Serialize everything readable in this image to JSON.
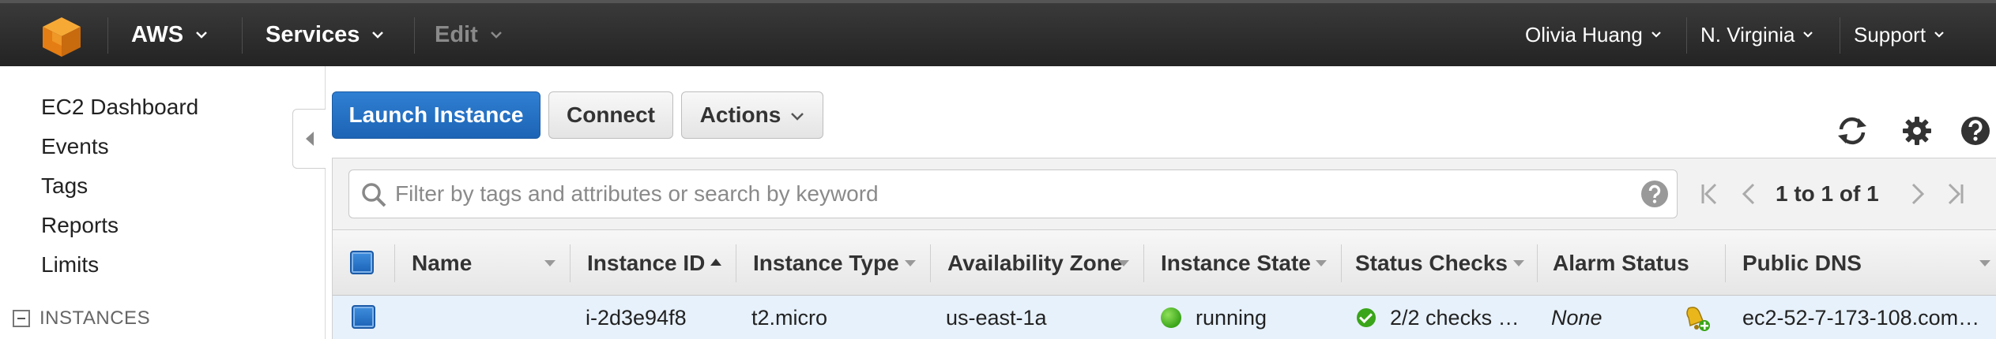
{
  "colors": {
    "topbar": "#232f3e",
    "primary_button": "#1d64b5",
    "logo_orange": "#f4931e",
    "running_green": "#3aa51a",
    "selected_row": "#e7f1fb"
  },
  "nav": {
    "brand": "AWS",
    "services": "Services",
    "edit": "Edit",
    "user": "Olivia Huang",
    "region": "N. Virginia",
    "support": "Support"
  },
  "sidebar": {
    "items": [
      {
        "label": "EC2 Dashboard"
      },
      {
        "label": "Events"
      },
      {
        "label": "Tags"
      },
      {
        "label": "Reports"
      },
      {
        "label": "Limits"
      }
    ],
    "section_label": "INSTANCES"
  },
  "toolbar": {
    "launch_label": "Launch Instance",
    "connect_label": "Connect",
    "actions_label": "Actions",
    "icons": [
      "refresh-icon",
      "gear-icon",
      "help-icon"
    ]
  },
  "filter": {
    "placeholder": "Filter by tags and attributes or search by keyword",
    "value": ""
  },
  "pagination": {
    "text": "1 to 1 of 1"
  },
  "table": {
    "columns": [
      {
        "label": "Name",
        "sort": "none"
      },
      {
        "label": "Instance ID",
        "sort": "asc"
      },
      {
        "label": "Instance Type",
        "sort": "none"
      },
      {
        "label": "Availability Zone",
        "sort": "none"
      },
      {
        "label": "Instance State",
        "sort": "none"
      },
      {
        "label": "Status Checks",
        "sort": "none"
      },
      {
        "label": "Alarm Status",
        "sort": "none"
      },
      {
        "label": "Public DNS",
        "sort": "none"
      }
    ],
    "rows": [
      {
        "selected": true,
        "name": "",
        "instance_id": "i-2d3e94f8",
        "instance_type": "t2.micro",
        "availability_zone": "us-east-1a",
        "instance_state": "running",
        "status_checks": "2/2 checks …",
        "alarm_status": "None",
        "public_dns": "ec2-52-7-173-108.com…"
      }
    ]
  }
}
